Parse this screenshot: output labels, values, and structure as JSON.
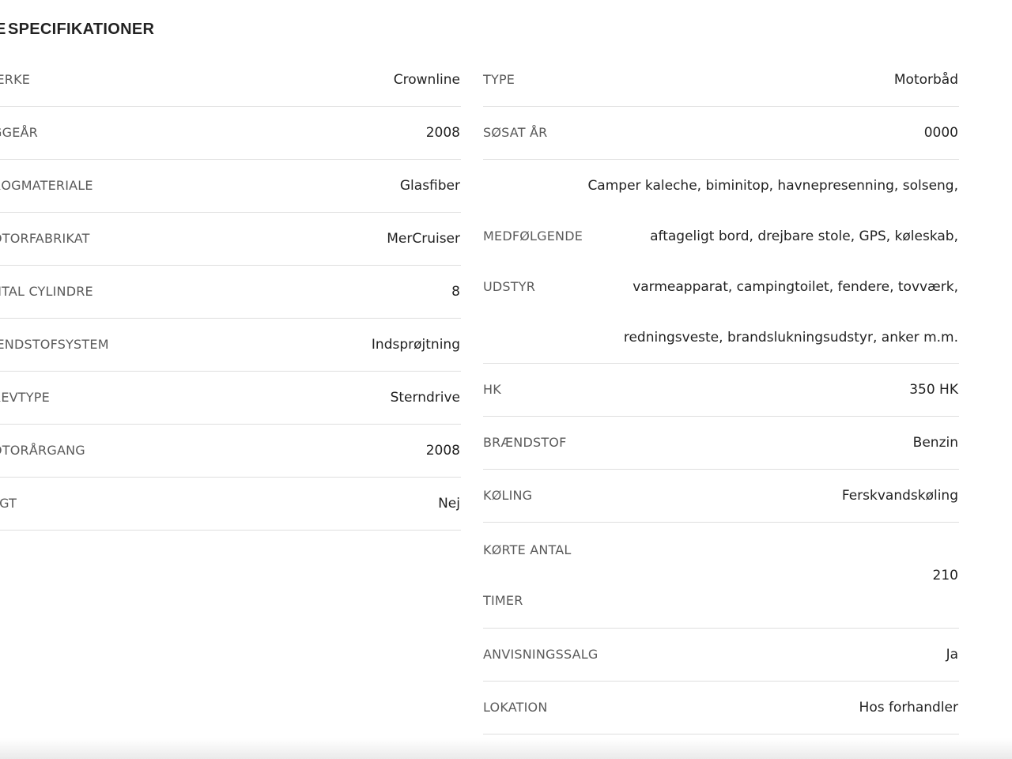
{
  "section": {
    "title": "SPECIFIKATIONER"
  },
  "left_specs": [
    {
      "label": "ÆRKE",
      "value": "Crownline"
    },
    {
      "label": "GGEÅR",
      "value": "2008"
    },
    {
      "label": "ROGMATERIALE",
      "value": "Glasfiber"
    },
    {
      "label": "OTORFABRIKAT",
      "value": "MerCruiser"
    },
    {
      "label": "NTAL CYLINDRE",
      "value": "8"
    },
    {
      "label": "ÆNDSTOFSYSTEM",
      "value": "Indsprøjtning"
    },
    {
      "label": "REVTYPE",
      "value": "Sterndrive"
    },
    {
      "label": "OTORÅRGANG",
      "value": "2008"
    },
    {
      "label": "LGT",
      "value": "Nej"
    }
  ],
  "right_specs": {
    "type": {
      "label": "TYPE",
      "value": "Motorbåd"
    },
    "launched": {
      "label": "SØSAT ÅR",
      "value": "0000"
    },
    "equipment": {
      "label_line1": "MEDFØLGENDE",
      "label_line2": "UDSTYR",
      "value_lines": [
        "Camper kaleche, biminitop, havnepresenning, solseng,",
        "aftageligt bord, drejbare stole, GPS, køleskab,",
        "varmeapparat, campingtoilet, fendere, tovværk,",
        "redningsveste, brandslukningsudstyr, anker m.m."
      ]
    },
    "hp": {
      "label": "HK",
      "value": "350 HK"
    },
    "fuel": {
      "label": "BRÆNDSTOF",
      "value": "Benzin"
    },
    "cooling": {
      "label": "KØLING",
      "value": "Ferskvandskøling"
    },
    "hours": {
      "label_line1": "KØRTE ANTAL",
      "label_line2": "TIMER",
      "value": "210"
    },
    "referral_sale": {
      "label": "ANVISNINGSSALG",
      "value": "Ja"
    },
    "location": {
      "label": "LOKATION",
      "value": "Hos forhandler"
    }
  }
}
